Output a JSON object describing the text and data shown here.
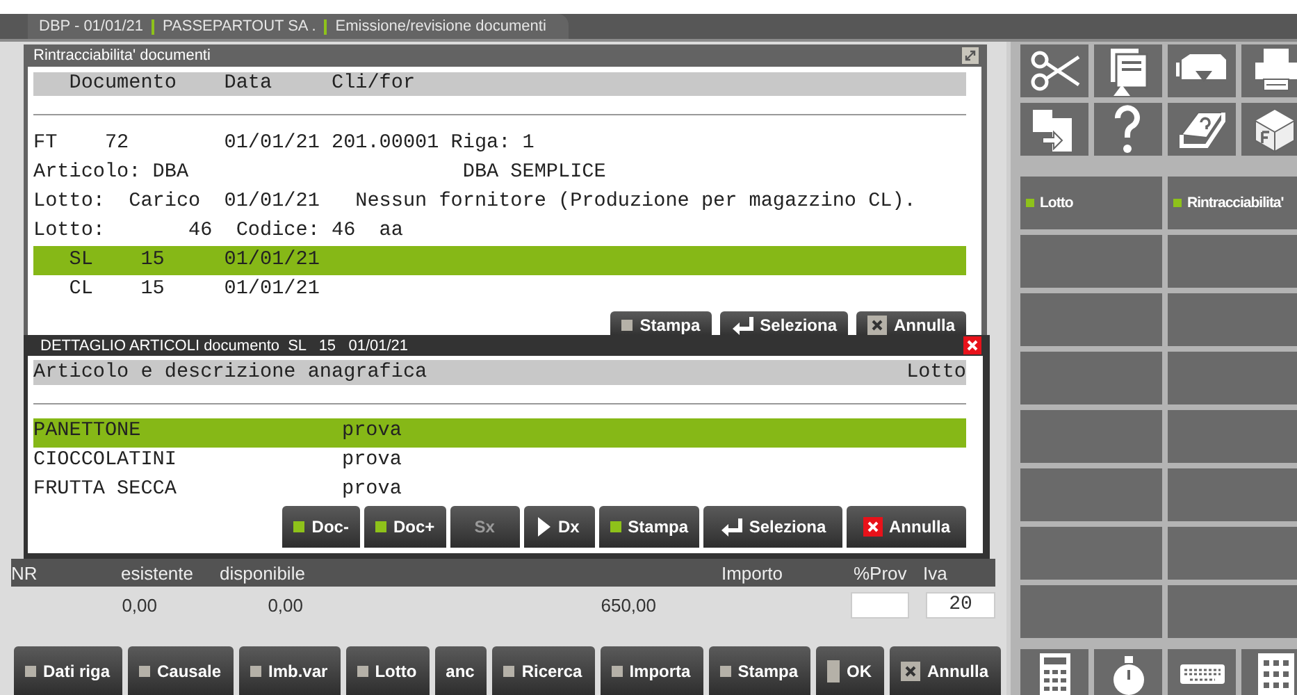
{
  "title_bar": {
    "segments": [
      "DBP - 01/01/21",
      "PASSEPARTOUT SA .",
      "Emissione/revisione documenti"
    ]
  },
  "trace_window": {
    "title": "Rintracciabilita' documenti",
    "header": "   Documento    Data     Cli/for",
    "lines": [
      "FT    72        01/01/21 201.00001 Riga: 1",
      "Articolo: DBA                       DBA SEMPLICE",
      "Lotto:  Carico  01/01/21   Nessun fornitore (Produzione per magazzino CL).",
      "Lotto:       46  Codice: 46  aa"
    ],
    "rows": [
      {
        "text": "   SL    15     01/01/21",
        "selected": true
      },
      {
        "text": "   CL    15     01/01/21",
        "selected": false
      }
    ],
    "buttons": [
      {
        "label": "Stampa",
        "kind": "gray"
      },
      {
        "label": "Seleziona",
        "kind": "enter"
      },
      {
        "label": "Annulla",
        "kind": "cancel-gray"
      }
    ]
  },
  "detail_window": {
    "title": "DETTAGLIO ARTICOLI documento  SL   15   01/01/21",
    "columns": [
      "Articolo e descrizione anagrafica",
      "Lotto"
    ],
    "rows": [
      {
        "article": "PANETTONE",
        "description": "prova",
        "selected": true
      },
      {
        "article": "CIOCCOLATINI",
        "description": "prova",
        "selected": false
      },
      {
        "article": "FRUTTA SECCA",
        "description": "prova",
        "selected": false
      }
    ],
    "buttons": [
      {
        "label": "Doc-",
        "kind": "green",
        "disabled": false
      },
      {
        "label": "Doc+",
        "kind": "green",
        "disabled": false
      },
      {
        "label": "Sx",
        "kind": "none",
        "disabled": true
      },
      {
        "label": "Dx",
        "kind": "play",
        "disabled": false
      },
      {
        "label": "Stampa",
        "kind": "green",
        "disabled": false
      },
      {
        "label": "Seleziona",
        "kind": "enter",
        "disabled": false
      },
      {
        "label": "Annulla",
        "kind": "cancel",
        "disabled": false
      }
    ]
  },
  "totals": {
    "columns": [
      "NR",
      "esistente",
      "disponibile",
      "Importo",
      "%Prov",
      "Iva"
    ],
    "esistente": "0,00",
    "disponibile": "0,00",
    "importo": "650,00",
    "iva": "20"
  },
  "toolbar": [
    {
      "label": "Dati riga",
      "kind": "gray"
    },
    {
      "label": "Causale",
      "kind": "gray"
    },
    {
      "label": "Imb.var",
      "kind": "gray"
    },
    {
      "label": "Lotto",
      "kind": "gray"
    },
    {
      "label": "anc",
      "kind": "none"
    },
    {
      "label": "Ricerca",
      "kind": "gray"
    },
    {
      "label": "Importa",
      "kind": "gray"
    },
    {
      "label": "Stampa",
      "kind": "gray"
    },
    {
      "label": "OK",
      "kind": "bar"
    },
    {
      "label": "Annulla",
      "kind": "cancel-gray"
    }
  ],
  "function_keys": [
    {
      "label": "Lotto"
    },
    {
      "label": "Rintracciabilita'"
    }
  ]
}
